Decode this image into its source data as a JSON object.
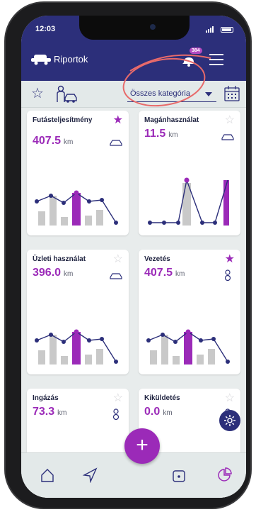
{
  "status": {
    "time": "12:03"
  },
  "app": {
    "title": "Riportok",
    "notification_count": "384"
  },
  "filter": {
    "category": "Összes kategória"
  },
  "colors": {
    "primary": "#2c2f7a",
    "accent": "#9b2ab8",
    "bar_gray": "#c9c9c9",
    "dot": "#2c2f7a"
  },
  "cards": [
    {
      "title": "Futásteljesítmény",
      "value": "407.5",
      "unit": "km",
      "starred": true,
      "icon": "car-icon"
    },
    {
      "title": "Magánhasználat",
      "value": "11.5",
      "unit": "km",
      "starred": false,
      "icon": "car-icon"
    },
    {
      "title": "Üzleti használat",
      "value": "396.0",
      "unit": "km",
      "starred": false,
      "icon": "car-icon"
    },
    {
      "title": "Vezetés",
      "value": "407.5",
      "unit": "km",
      "starred": true,
      "icon": "driver-icon"
    },
    {
      "title": "Ingázás",
      "value": "73.3",
      "unit": "km",
      "starred": false,
      "icon": "driver-icon"
    },
    {
      "title": "Kiküldetés",
      "value": "0.0",
      "unit": "km",
      "starred": false,
      "icon": "driver-icon"
    }
  ],
  "nav": {
    "items": [
      "home-icon",
      "navigate-icon",
      "add-button",
      "trip-icon",
      "reports-icon"
    ],
    "fab_label": "+"
  }
}
